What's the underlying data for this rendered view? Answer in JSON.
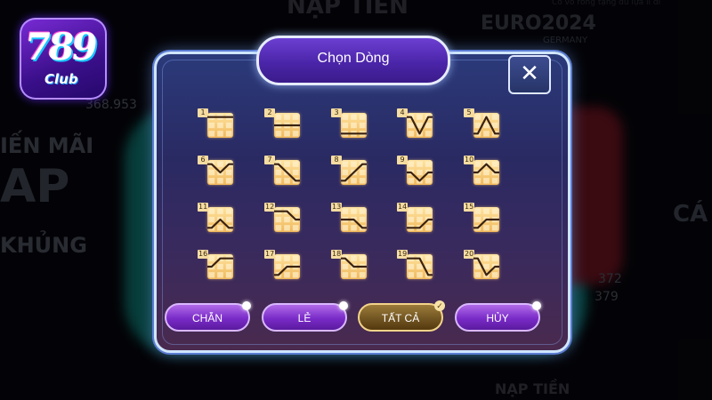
{
  "logo": {
    "number": "789",
    "sub": "Club"
  },
  "background": {
    "top_banner": "NẠP TIỀN",
    "euro": "EURO2024",
    "euro_sub": "GERMANY",
    "balance": "368.953",
    "promo_line1": "IẾN MÃI",
    "promo_line2": "AP",
    "promo_line3": "KHỦNG",
    "right_text": "CÁ",
    "right_nums": [
      "372",
      "379"
    ],
    "top_ticker": "Cô vô rồng tặng đủ lựa lì đĩ",
    "bottom_label": "NẠP TIỀN"
  },
  "modal": {
    "title": "Chọn Dòng",
    "close_symbol": "✕"
  },
  "lines": [
    {
      "n": "1",
      "type": "top-row"
    },
    {
      "n": "2",
      "type": "middle-row"
    },
    {
      "n": "3",
      "type": "bottom-row"
    },
    {
      "n": "4",
      "type": "v"
    },
    {
      "n": "5",
      "type": "inverted-v"
    },
    {
      "n": "6",
      "type": "shallow-v"
    },
    {
      "n": "7",
      "type": "diagonal-down"
    },
    {
      "n": "8",
      "type": "diagonal-up"
    },
    {
      "n": "9",
      "type": "mid-v"
    },
    {
      "n": "10",
      "type": "mid-inverted-v"
    },
    {
      "n": "11",
      "type": "low-inverted-v"
    },
    {
      "n": "12",
      "type": "top-step-down"
    },
    {
      "n": "13",
      "type": "mid-step-down"
    },
    {
      "n": "14",
      "type": "low-step-up"
    },
    {
      "n": "15",
      "type": "bottom-step-up"
    },
    {
      "n": "16",
      "type": "bottom-to-top"
    },
    {
      "n": "17",
      "type": "mid-step-up"
    },
    {
      "n": "18",
      "type": "top-to-mid"
    },
    {
      "n": "19",
      "type": "top-to-bottom"
    },
    {
      "n": "20",
      "type": "top-v"
    }
  ],
  "buttons": {
    "even": "CHẴN",
    "odd": "LẺ",
    "all": "TẤT CẢ",
    "cancel": "HỦY",
    "check_symbol": "✓"
  },
  "colors": {
    "modal_border": "#cfe6ff",
    "tile": "#f0b85a",
    "line_stroke": "#3a2210",
    "button_purple": "#7a2bc8",
    "button_gold": "#6e5220"
  }
}
